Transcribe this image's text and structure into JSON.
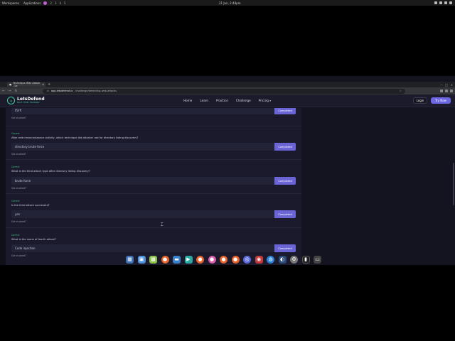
{
  "os_bar": {
    "workspaces": "Workspaces",
    "applications": "Applications",
    "workspace_numbers": [
      "2",
      "3",
      "4",
      "5"
    ],
    "clock": "21 Jun, 2:48pm"
  },
  "browser": {
    "tab_title": "Technique Wiki Attack - Le",
    "url_host": "app.letsdefend.io",
    "url_path": "/challenge/detecting-web-attacks"
  },
  "site": {
    "logo_name": "LetsDefend",
    "logo_tag": "BLUE TEAM TRAINING",
    "nav": [
      "Home",
      "Learn",
      "Practice",
      "Challenge",
      "Pricing"
    ],
    "login": "Login",
    "try_now": "Try Now"
  },
  "questions": [
    {
      "tag": "",
      "question": "",
      "answer": "lfi/rfi",
      "button": "Completed",
      "stuck": "Got stucked?"
    },
    {
      "tag": "Correct",
      "question": "After web reconnaissance activity, which technique did attacker use for directory listing discovery?",
      "answer": "directory brute force",
      "button": "Completed",
      "stuck": "Got stucked?"
    },
    {
      "tag": "Correct",
      "question": "What is the third attack type after directory listing discovery?",
      "answer": "brute force",
      "button": "Completed",
      "stuck": "Got stucked?"
    },
    {
      "tag": "Correct",
      "question": "Is the third attack successful?",
      "answer": "yes",
      "button": "Completed",
      "stuck": "Got stucked?"
    },
    {
      "tag": "Correct",
      "question": "What is the name of fourth attack?",
      "answer": "Code injection",
      "button": "Completed",
      "stuck": "Got stucked?"
    }
  ],
  "colors": {
    "accent": "#6d67e4",
    "correct": "#3fbf7f",
    "page_bg": "#141420",
    "card_bg": "#1a1a2c"
  }
}
